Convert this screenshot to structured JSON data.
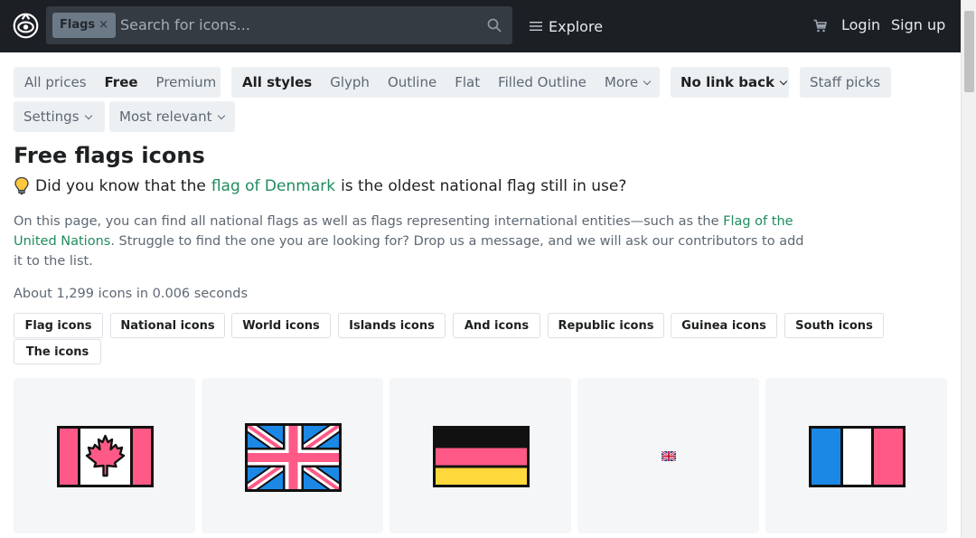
{
  "header": {
    "search_chip": "Flags",
    "search_chip_remove": "×",
    "search_placeholder": "Search for icons...",
    "explore_label": "Explore",
    "login_label": "Login",
    "signup_label": "Sign up",
    "icons": [
      "logo-icon",
      "close-icon",
      "search-icon",
      "menu-icon",
      "cart-icon"
    ]
  },
  "filters": {
    "prices": [
      "All prices",
      "Free",
      "Premium"
    ],
    "styles": [
      "All styles",
      "Glyph",
      "Outline",
      "Flat",
      "Filled Outline",
      "More"
    ],
    "link_back": "No link back",
    "staff_picks": "Staff picks",
    "settings": "Settings",
    "sort": "Most relevant"
  },
  "page": {
    "title": "Free flags icons",
    "didyou_prefix": "Did you know that the",
    "didyou_link": "flag of Denmark",
    "didyou_suffix": "is the oldest national flag still in use?",
    "desc_part1": "On this page, you can find all national flags as well as flags representing international entities—such as the",
    "desc_link": "Flag of the United Nations",
    "desc_part2": ". Struggle to find the one you are looking for? Drop us a message, and we will ask our contributors to add it to the list.",
    "count_text": "About 1,299 icons in 0.006 seconds"
  },
  "tags": [
    "Flag icons",
    "National icons",
    "World icons",
    "Islands icons",
    "And icons",
    "Republic icons",
    "Guinea icons",
    "South icons",
    "The icons"
  ],
  "icons": [
    {
      "name": "canada-flag-icon"
    },
    {
      "name": "united-kingdom-flag-icon"
    },
    {
      "name": "germany-flag-icon"
    },
    {
      "name": "small-united-kingdom-flag-icon"
    },
    {
      "name": "france-flag-icon"
    }
  ],
  "colors": {
    "header_bg": "#1c2025",
    "accent_green": "#1f8c5d",
    "flag_pink": "#ff5a87",
    "flag_blue": "#1c88e6",
    "flag_yellow": "#ffd83b"
  }
}
